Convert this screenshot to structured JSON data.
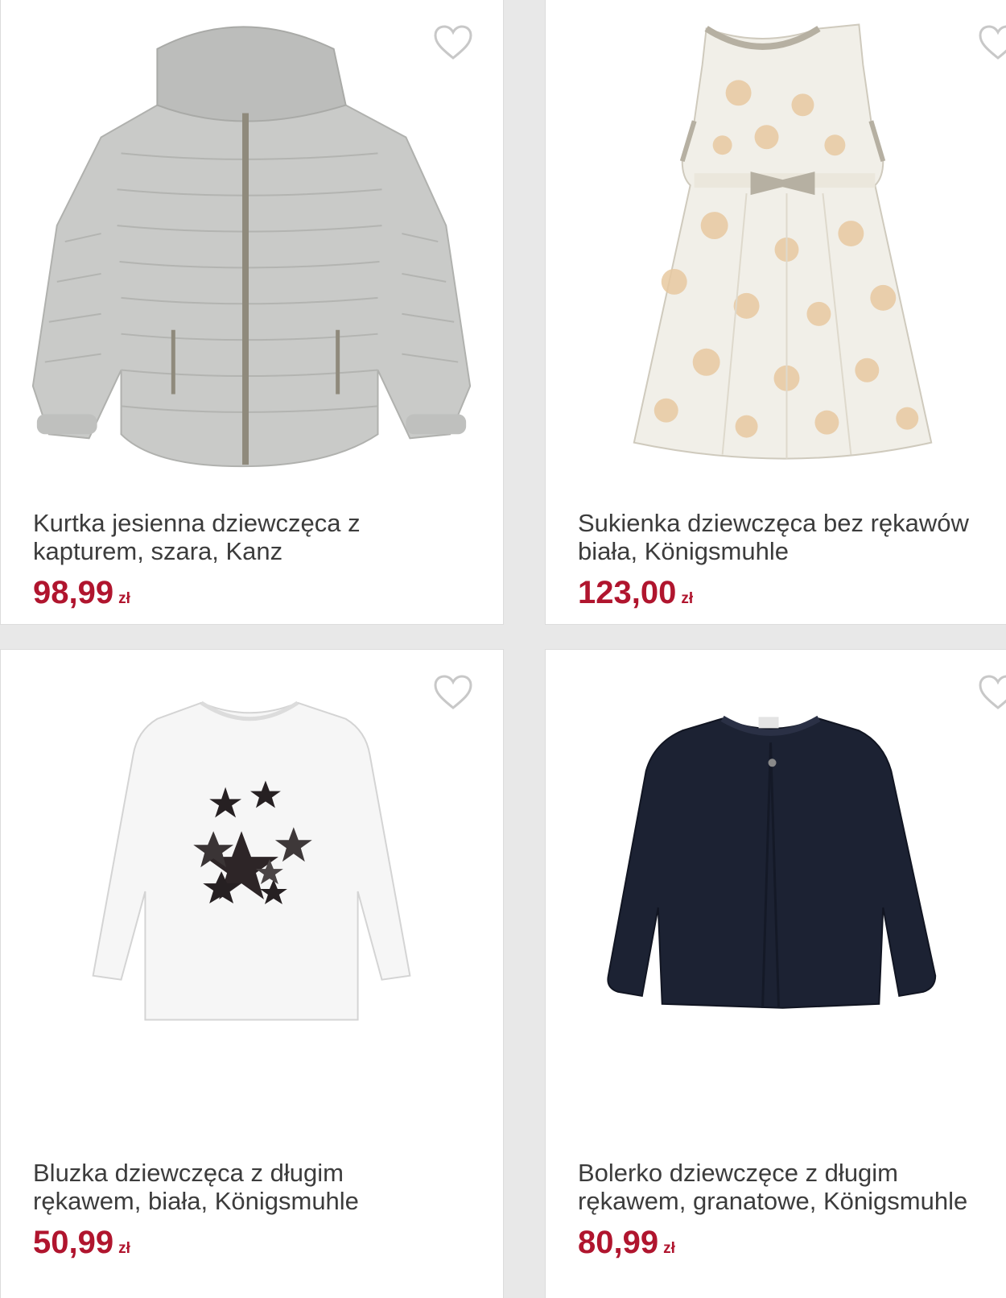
{
  "colors": {
    "price": "#b0152e",
    "title": "#3c3c3c",
    "heart": "#c8c8c8",
    "background": "#e8e8e8"
  },
  "products": [
    {
      "title_line1": "Kurtka jesienna dziewczęca z",
      "title_line2": "kapturem, szara, Kanz",
      "price": "98,99",
      "currency": "zł",
      "favorite_icon": "heart-outline-icon",
      "image": "grey puffer jacket with hood"
    },
    {
      "title_line1": "Sukienka dziewczęca bez rękawów",
      "title_line2": "biała, Königsmuhle",
      "price": "123,00",
      "currency": "zł",
      "favorite_icon": "heart-outline-icon",
      "image": "white sleeveless dress with peach floral pattern"
    },
    {
      "title_line1": "Bluzka dziewczęca z długim",
      "title_line2": "rękawem, biała, Königsmuhle",
      "price": "50,99",
      "currency": "zł",
      "favorite_icon": "heart-outline-icon",
      "image": "white long-sleeve top with sequin stars"
    },
    {
      "title_line1": "Bolerko dziewczęce z długim",
      "title_line2": "rękawem, granatowe, Königsmuhle",
      "price": "80,99",
      "currency": "zł",
      "favorite_icon": "heart-outline-icon",
      "image": "navy cropped cardigan"
    }
  ]
}
